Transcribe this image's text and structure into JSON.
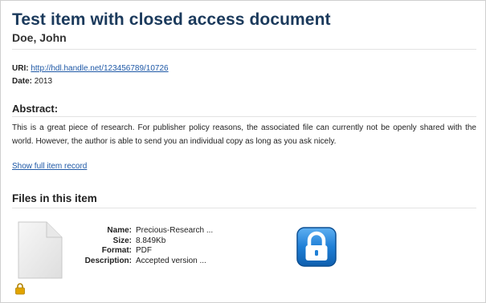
{
  "item": {
    "title": "Test item with closed access document",
    "author": "Doe, John"
  },
  "metadata": {
    "uri_label": "URI:",
    "uri_value": "http://hdl.handle.net/123456789/10726",
    "date_label": "Date:",
    "date_value": "2013"
  },
  "abstract": {
    "heading": "Abstract:",
    "text": "This is a great piece of research. For publisher policy reasons, the associated file can currently not be openly shared with the world. However, the author is able to send you an individual copy as long as you ask nicely."
  },
  "links": {
    "show_full": "Show full item record"
  },
  "files": {
    "heading": "Files in this item",
    "name_label": "Name:",
    "name_value": "Precious-Research ...",
    "size_label": "Size:",
    "size_value": "8.849Kb",
    "format_label": "Format:",
    "format_value": "PDF",
    "description_label": "Description:",
    "description_value": "Accepted version ...",
    "icons": {
      "document": "document-icon",
      "small_lock": "padlock-icon",
      "request_copy": "lock-icon"
    }
  },
  "colors": {
    "title": "#1b3a5c",
    "link": "#1e58a6",
    "lock_button": "#1f7fd6",
    "small_lock": "#e2a400"
  }
}
